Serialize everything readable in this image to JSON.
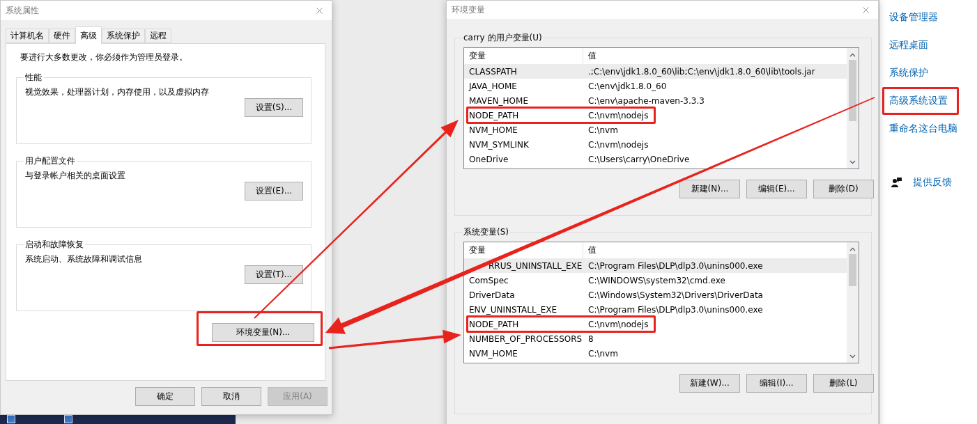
{
  "system_properties": {
    "title": "系统属性",
    "tabs": [
      {
        "label": "计算机名",
        "selected": false
      },
      {
        "label": "硬件",
        "selected": false
      },
      {
        "label": "高级",
        "selected": true
      },
      {
        "label": "系统保护",
        "selected": false
      },
      {
        "label": "远程",
        "selected": false
      }
    ],
    "notice": "要进行大多数更改，你必须作为管理员登录。",
    "groups": [
      {
        "title": "性能",
        "description": "视觉效果，处理器计划，内存使用，以及虚拟内存",
        "button": "设置(S)..."
      },
      {
        "title": "用户配置文件",
        "description": "与登录帐户相关的桌面设置",
        "button": "设置(E)..."
      },
      {
        "title": "启动和故障恢复",
        "description": "系统启动、系统故障和调试信息",
        "button": "设置(T)..."
      }
    ],
    "env_button": {
      "label": "环境变量(N)...",
      "highlighted": true
    },
    "footer_buttons": [
      {
        "label": "确定",
        "disabled": false
      },
      {
        "label": "取消",
        "disabled": false
      },
      {
        "label": "应用(A)",
        "disabled": true
      }
    ]
  },
  "environment_variables": {
    "title": "环境变量",
    "sections": [
      {
        "title": "carry 的用户变量(U)",
        "columns": [
          "变量",
          "值"
        ],
        "rows": [
          {
            "name": "CLASSPATH",
            "value": ".;C:\\env\\jdk1.8.0_60\\lib;C:\\env\\jdk1.8.0_60\\lib\\tools.jar",
            "selected": true,
            "highlighted": false
          },
          {
            "name": "JAVA_HOME",
            "value": "C:\\env\\jdk1.8.0_60",
            "selected": false,
            "highlighted": false
          },
          {
            "name": "MAVEN_HOME",
            "value": "C:\\env\\apache-maven-3.3.3",
            "selected": false,
            "highlighted": false
          },
          {
            "name": "NODE_PATH",
            "value": "C:\\nvm\\nodejs",
            "selected": false,
            "highlighted": true
          },
          {
            "name": "NVM_HOME",
            "value": "C:\\nvm",
            "selected": false,
            "highlighted": false
          },
          {
            "name": "NVM_SYMLINK",
            "value": "C:\\nvm\\nodejs",
            "selected": false,
            "highlighted": false
          },
          {
            "name": "OneDrive",
            "value": "C:\\Users\\carry\\OneDrive",
            "selected": false,
            "highlighted": false
          }
        ],
        "buttons": [
          "新建(N)...",
          "编辑(E)...",
          "删除(D)"
        ]
      },
      {
        "title": "系统变量(S)",
        "columns": [
          "变量",
          "值"
        ],
        "rows": [
          {
            "name": "RRUS_UNINSTALL_EXE",
            "value": "C:\\Program Files\\DLP\\dlp3.0\\unins000.exe",
            "selected": true,
            "highlighted": false
          },
          {
            "name": "ComSpec",
            "value": "C:\\WINDOWS\\system32\\cmd.exe",
            "selected": false,
            "highlighted": false
          },
          {
            "name": "DriverData",
            "value": "C:\\Windows\\System32\\Drivers\\DriverData",
            "selected": false,
            "highlighted": false
          },
          {
            "name": "ENV_UNINSTALL_EXE",
            "value": "C:\\Program Files\\DLP\\dlp3.0\\unins000.exe",
            "selected": false,
            "highlighted": false
          },
          {
            "name": "NODE_PATH",
            "value": "C:\\nvm\\nodejs",
            "selected": false,
            "highlighted": true
          },
          {
            "name": "NUMBER_OF_PROCESSORS",
            "value": "8",
            "selected": false,
            "highlighted": false
          },
          {
            "name": "NVM_HOME",
            "value": "C:\\nvm",
            "selected": false,
            "highlighted": false
          }
        ],
        "buttons": [
          "新建(W)...",
          "编辑(I)...",
          "删除(L)"
        ]
      }
    ]
  },
  "sidebar": {
    "links": [
      {
        "label": "设备管理器",
        "highlighted": false
      },
      {
        "label": "远程桌面",
        "highlighted": false
      },
      {
        "label": "系统保护",
        "highlighted": false
      },
      {
        "label": "高级系统设置",
        "highlighted": true
      },
      {
        "label": "重命名这台电脑",
        "highlighted": false
      }
    ],
    "feedback": "提供反馈"
  }
}
